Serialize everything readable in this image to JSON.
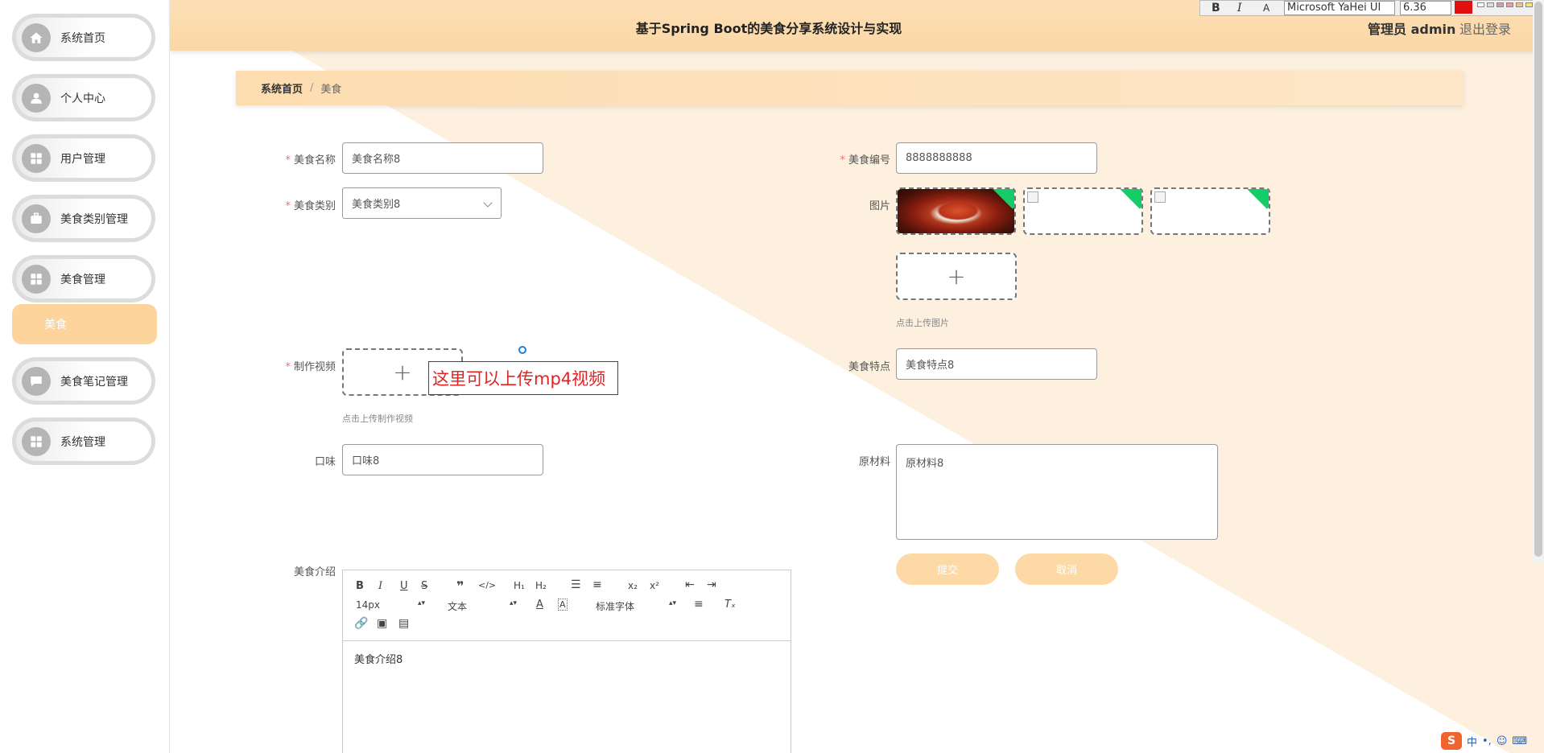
{
  "app": {
    "title": "基于Spring Boot的美食分享系统设计与实现",
    "user": "管理员 admin",
    "logout": "退出登录"
  },
  "sidebar": {
    "items": [
      {
        "label": "系统首页",
        "icon": "home-icon"
      },
      {
        "label": "个人中心",
        "icon": "user-icon"
      },
      {
        "label": "用户管理",
        "icon": "grid-icon"
      },
      {
        "label": "美食类别管理",
        "icon": "briefcase-icon"
      },
      {
        "label": "美食管理",
        "icon": "grid-icon"
      },
      {
        "label": "美食笔记管理",
        "icon": "chat-icon"
      },
      {
        "label": "系统管理",
        "icon": "grid-icon"
      }
    ],
    "active_sub": "美食"
  },
  "breadcrumb": {
    "home": "系统首页",
    "sep": "/",
    "current": "美食"
  },
  "form": {
    "name_label": "美食名称",
    "name_value": "美食名称8",
    "code_label": "美食编号",
    "code_value": "8888888888",
    "category_label": "美食类别",
    "category_value": "美食类别8",
    "image_label": "图片",
    "image_hint": "点击上传图片",
    "video_label": "制作视频",
    "video_hint": "点击上传制作视频",
    "feature_label": "美食特点",
    "feature_value": "美食特点8",
    "taste_label": "口味",
    "taste_value": "口味8",
    "material_label": "原材料",
    "material_value": "原材料8",
    "intro_label": "美食介绍",
    "intro_value": "美食介绍8",
    "submit": "提交",
    "cancel": "取消",
    "required_mark": "*"
  },
  "annotation": {
    "text": "这里可以上传mp4视频"
  },
  "editor": {
    "font_size": "14px",
    "paragraph": "文本",
    "font_family": "标准字体"
  },
  "float_toolbar": {
    "font": "Microsoft YaHei UI",
    "size": "6.36"
  },
  "tray": {
    "ime": "中"
  },
  "colors": {
    "accent": "#fdd49c",
    "header": "#fbd7a6",
    "required": "#f56c6c",
    "annotation": "#e02424",
    "upload_corner": "#13ce66"
  }
}
